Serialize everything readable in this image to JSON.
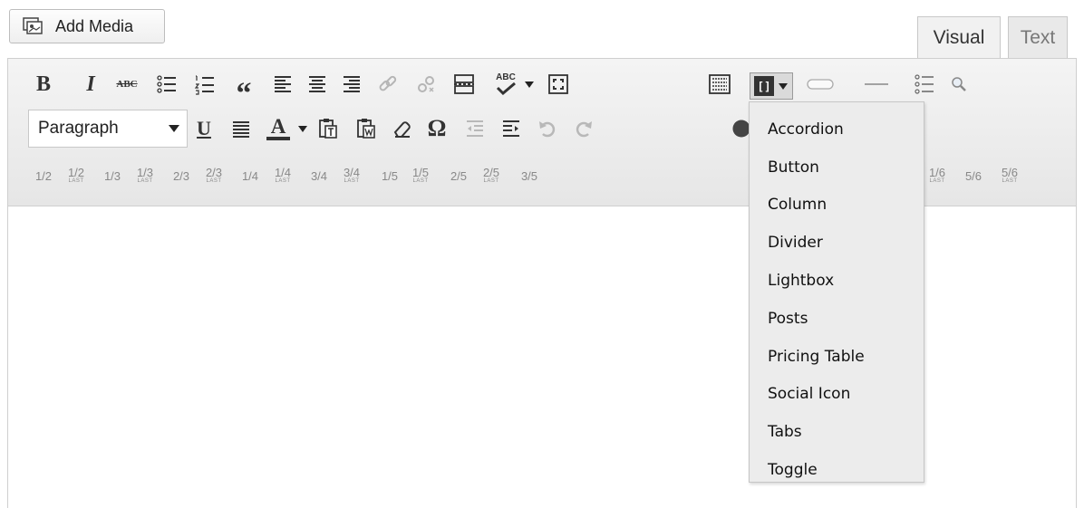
{
  "media": {
    "add_label": "Add Media",
    "icon": "media-icon"
  },
  "modes": {
    "visual": "Visual",
    "text": "Text"
  },
  "toolbar": {
    "bold": "B",
    "italic": "I",
    "strike": "ABC",
    "blockquote": "“",
    "underline": "U",
    "text_color": "A",
    "omega": "Ω",
    "spellcheck": "ABC",
    "format": "Paragraph"
  },
  "shortcodes": {
    "items": [
      "Accordion",
      "Button",
      "Column",
      "Divider",
      "Lightbox",
      "Posts",
      "Pricing Table",
      "Social Icon",
      "Tabs",
      "Toggle"
    ]
  },
  "columns": {
    "last_label": "LAST",
    "items": [
      {
        "label": "1/2",
        "last": false
      },
      {
        "label": "1/2",
        "last": true
      },
      {
        "label": "1/3",
        "last": false
      },
      {
        "label": "1/3",
        "last": true
      },
      {
        "label": "2/3",
        "last": false
      },
      {
        "label": "2/3",
        "last": true
      },
      {
        "label": "1/4",
        "last": false
      },
      {
        "label": "1/4",
        "last": true
      },
      {
        "label": "3/4",
        "last": false
      },
      {
        "label": "3/4",
        "last": true
      },
      {
        "label": "1/5",
        "last": false
      },
      {
        "label": "1/5",
        "last": true
      },
      {
        "label": "2/5",
        "last": false
      },
      {
        "label": "2/5",
        "last": true
      },
      {
        "label": "3/5",
        "last": false
      },
      {
        "label": "1/6",
        "last": true
      },
      {
        "label": "5/6",
        "last": false
      },
      {
        "label": "5/6",
        "last": true
      }
    ]
  }
}
